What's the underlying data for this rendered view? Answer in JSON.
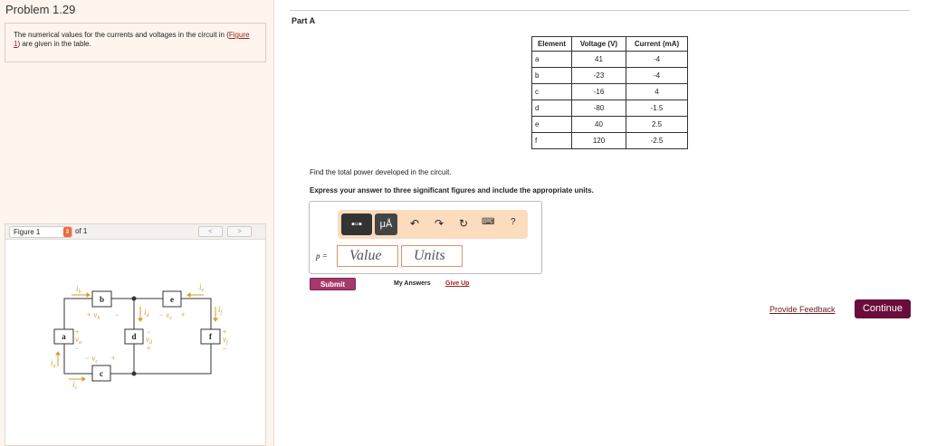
{
  "problem": {
    "title": "Problem 1.29",
    "intro_before": "The numerical values for the currents and voltages in the circuit in (",
    "figure_link": "Figure 1",
    "intro_after": ") are given in the table."
  },
  "figure": {
    "selector": "Figure 1",
    "of": "of 1",
    "prev": "<",
    "next": ">",
    "labels": {
      "a": "a",
      "b": "b",
      "c_top": "e",
      "d": "d",
      "f": "f",
      "c_bot": "c",
      "ib": "i",
      "ib_sub": "b",
      "ie": "i",
      "ie_sub": "e",
      "id": "i",
      "id_sub": "d",
      "if": "i",
      "if_sub": "f",
      "ia": "i",
      "ia_sub": "a",
      "ic": "i",
      "ic_sub": "c",
      "vb": "+ vₕ −",
      "vb_text": "+  v",
      "vb_sub": "b",
      "ve_text": "− v",
      "ve_sub": "e",
      "va": "v",
      "va_sub": "a",
      "vd": "v",
      "vd_sub": "d",
      "vf": "v",
      "vf_sub": "f",
      "vc_text": "−  v",
      "vc_sub": "c",
      "plus": "+",
      "minus": "−"
    }
  },
  "part": {
    "title": "Part A"
  },
  "table": {
    "headers": [
      "Element",
      "Voltage (V)",
      "Current (mA)"
    ],
    "rows": [
      [
        "a",
        "41",
        "-4"
      ],
      [
        "b",
        "-23",
        "-4"
      ],
      [
        "c",
        "-16",
        "4"
      ],
      [
        "d",
        "-80",
        "-1.5"
      ],
      [
        "e",
        "40",
        "2.5"
      ],
      [
        "f",
        "120",
        "-2.5"
      ]
    ]
  },
  "question": "Find the total power developed in the circuit.",
  "instruction": "Express your answer to three significant figures and include the appropriate units.",
  "answer": {
    "label": "p =",
    "value_placeholder": "Value",
    "units_placeholder": "Units",
    "toolbar": {
      "units_btn": "μÅ",
      "help": "?"
    }
  },
  "buttons": {
    "submit": "Submit",
    "my_answers": "My Answers",
    "give_up": "Give Up",
    "feedback": "Provide Feedback",
    "continue": "Continue"
  }
}
